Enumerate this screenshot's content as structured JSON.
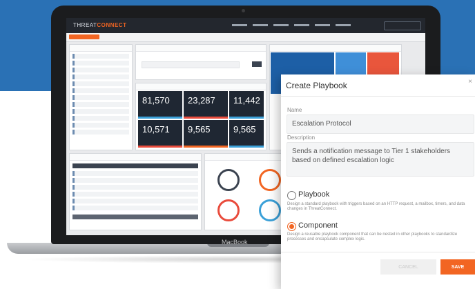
{
  "app": {
    "logo_text": "THREAT",
    "logo_accent": "CONNECT"
  },
  "tiles": [
    {
      "value": "81,570",
      "bar_color": "#3aa0d8"
    },
    {
      "value": "23,287",
      "bar_color": "#e94b3c"
    },
    {
      "value": "11,442",
      "bar_color": "#3aa0d8"
    },
    {
      "value": "10,571",
      "bar_color": "#e94b3c"
    },
    {
      "value": "9,565",
      "bar_color": "#f26522"
    },
    {
      "value": "9,565",
      "bar_color": "#3aa0d8"
    }
  ],
  "device": {
    "brand": "MacBook"
  },
  "dialog": {
    "title": "Create Playbook",
    "close": "×",
    "name_label": "Name",
    "name_value": "Escalation Protocol",
    "description_label": "Description",
    "description_value": "Sends a notification message to Tier 1 stakeholders based on defined escalation logic",
    "options": [
      {
        "title": "Playbook",
        "desc": "Design a standard playbook with triggers based on an HTTP request, a mailbox, timers, and data changes in ThreatConnect.",
        "selected": false
      },
      {
        "title": "Component",
        "desc": "Design a reusable playbook component that can be nested in other playbooks to standardize processes and encapsulate complex logic.",
        "selected": true
      }
    ],
    "cancel_label": "CANCEL",
    "save_label": "SAVE"
  },
  "colors": {
    "accent": "#f26522",
    "header_blue": "#2a71b5",
    "dark_tile": "#1f2733"
  }
}
